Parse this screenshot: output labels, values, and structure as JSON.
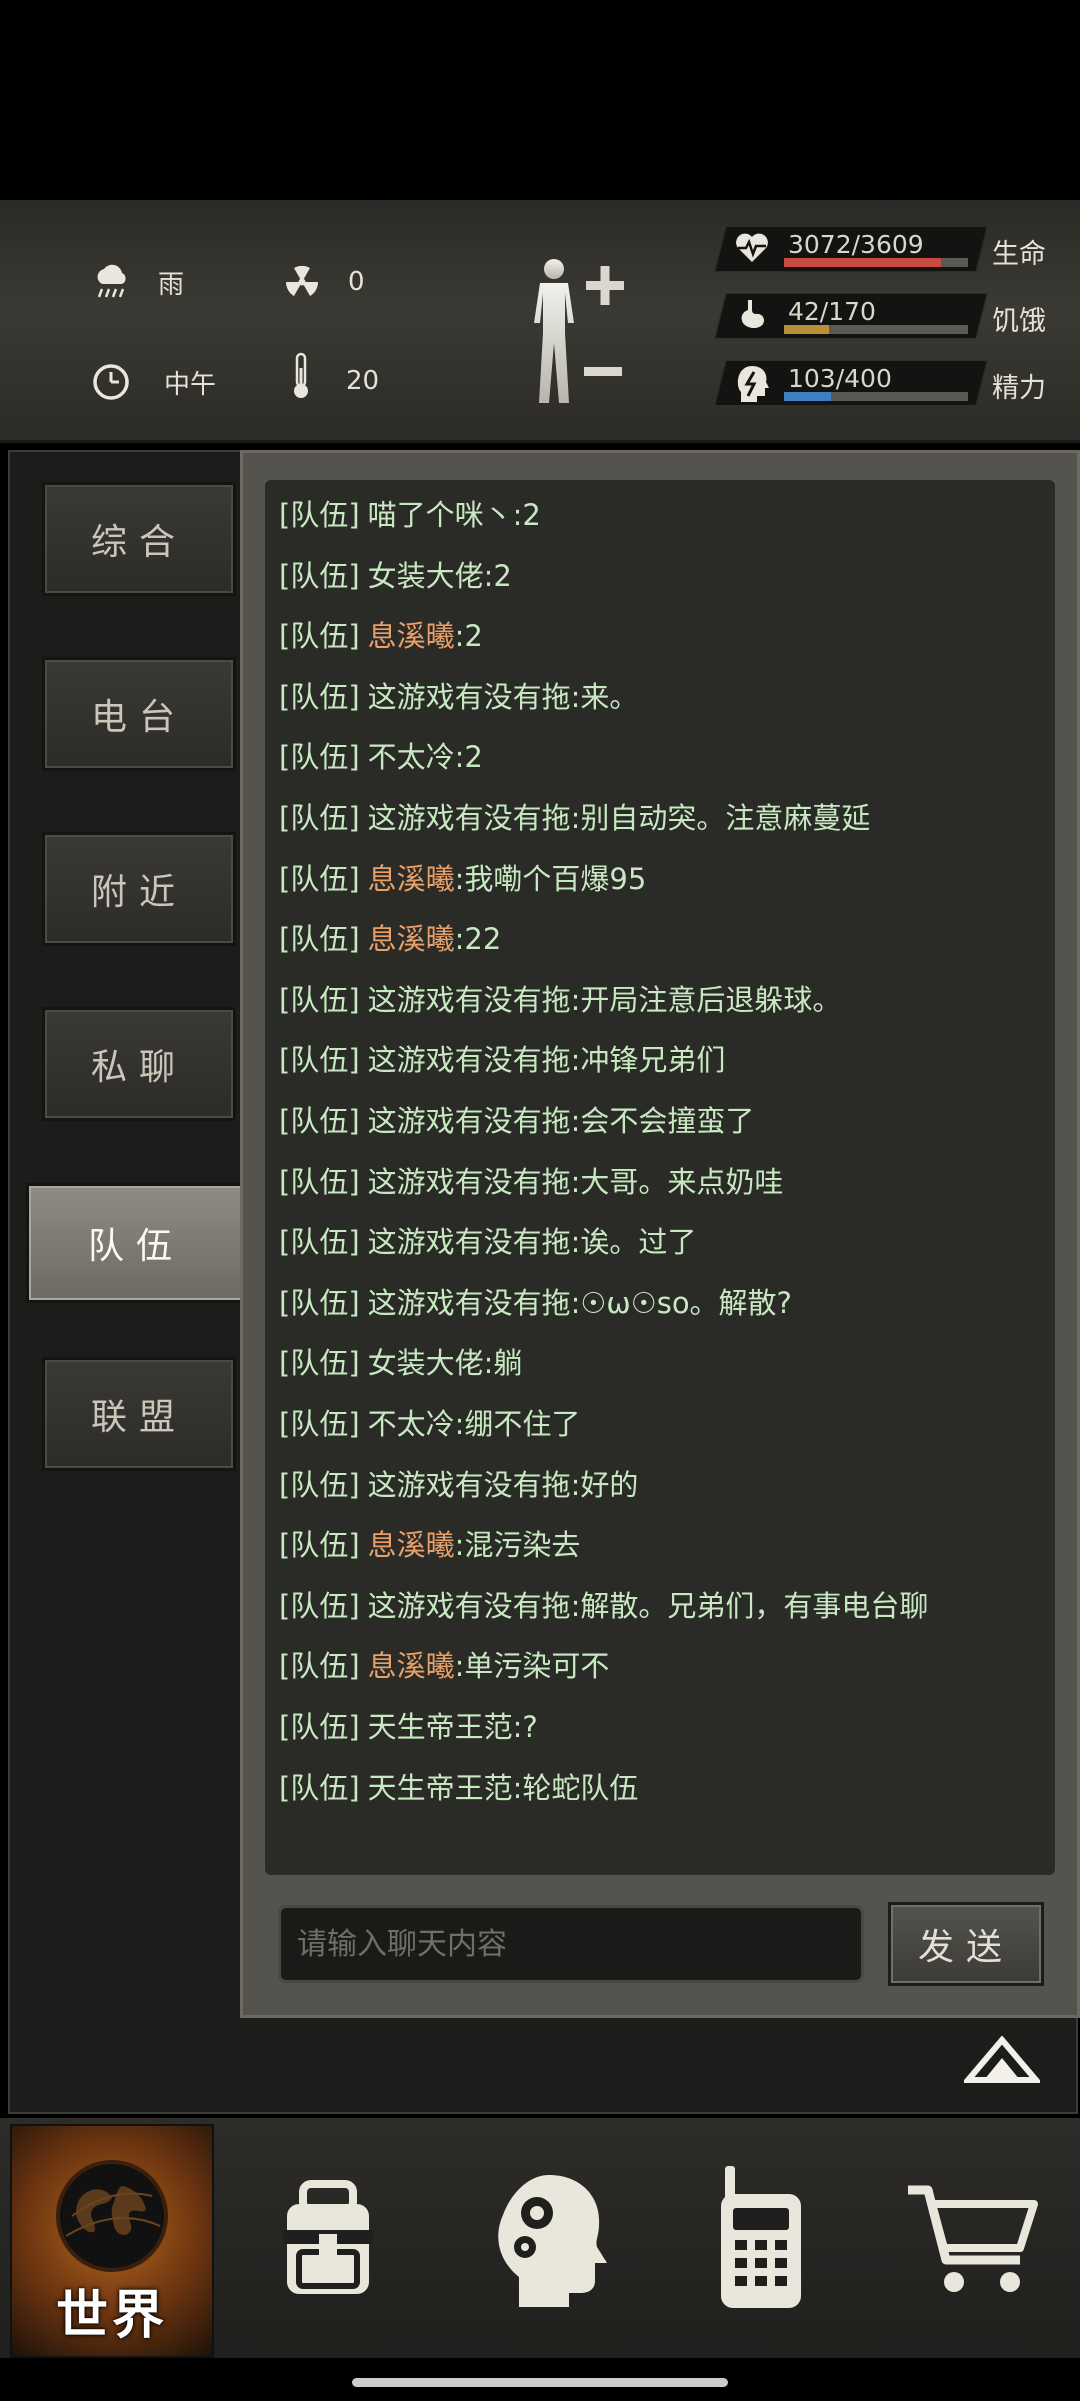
{
  "status": {
    "weather": "雨",
    "radiation": "0",
    "time_of_day": "中午",
    "temperature": "20",
    "health": {
      "value": "3072/3609",
      "label": "生命",
      "fraction": 0.851,
      "color": "#c94a3e"
    },
    "hunger": {
      "value": "42/170",
      "label": "饥饿",
      "fraction": 0.247,
      "color": "#b8903a"
    },
    "energy": {
      "value": "103/400",
      "label": "精力",
      "fraction": 0.258,
      "color": "#3f7fc4"
    }
  },
  "tabs": [
    {
      "label": "综合",
      "active": false
    },
    {
      "label": "电台",
      "active": false
    },
    {
      "label": "附近",
      "active": false
    },
    {
      "label": "私聊",
      "active": false
    },
    {
      "label": "队伍",
      "active": true
    },
    {
      "label": "联盟",
      "active": false
    }
  ],
  "chat": {
    "messages": [
      {
        "channel": "[队伍]",
        "name": "喵了个咪丶",
        "text": ":2",
        "highlight": false
      },
      {
        "channel": "[队伍]",
        "name": "女装大佬",
        "text": ":2",
        "highlight": false
      },
      {
        "channel": "[队伍]",
        "name": "息溪曦",
        "text": ":2",
        "highlight": true
      },
      {
        "channel": "[队伍]",
        "name": "这游戏有没有拖",
        "text": ":来。",
        "highlight": false
      },
      {
        "channel": "[队伍]",
        "name": "不太冷",
        "text": ":2",
        "highlight": false
      },
      {
        "channel": "[队伍]",
        "name": "这游戏有没有拖",
        "text": ":别自动突。注意麻蔓延",
        "highlight": false
      },
      {
        "channel": "[队伍]",
        "name": "息溪曦",
        "text": ":我嘞个百爆95",
        "highlight": true
      },
      {
        "channel": "[队伍]",
        "name": "息溪曦",
        "text": ":22",
        "highlight": true
      },
      {
        "channel": "[队伍]",
        "name": "这游戏有没有拖",
        "text": ":开局注意后退躲球。",
        "highlight": false
      },
      {
        "channel": "[队伍]",
        "name": "这游戏有没有拖",
        "text": ":冲锋兄弟们",
        "highlight": false
      },
      {
        "channel": "[队伍]",
        "name": "这游戏有没有拖",
        "text": ":会不会撞蛮了",
        "highlight": false
      },
      {
        "channel": "[队伍]",
        "name": "这游戏有没有拖",
        "text": ":大哥。来点奶哇",
        "highlight": false
      },
      {
        "channel": "[队伍]",
        "name": "这游戏有没有拖",
        "text": ":诶。过了",
        "highlight": false
      },
      {
        "channel": "[队伍]",
        "name": "这游戏有没有拖",
        "text": ":☉ω☉so。解散?",
        "highlight": false
      },
      {
        "channel": "[队伍]",
        "name": "女装大佬",
        "text": ":躺",
        "highlight": false
      },
      {
        "channel": "[队伍]",
        "name": "不太冷",
        "text": ":绷不住了",
        "highlight": false
      },
      {
        "channel": "[队伍]",
        "name": "这游戏有没有拖",
        "text": ":好的",
        "highlight": false
      },
      {
        "channel": "[队伍]",
        "name": "息溪曦",
        "text": ":混污染去",
        "highlight": true
      },
      {
        "channel": "[队伍]",
        "name": "这游戏有没有拖",
        "text": ":解散。兄弟们，有事电台聊",
        "highlight": false
      },
      {
        "channel": "[队伍]",
        "name": "息溪曦",
        "text": ":单污染可不",
        "highlight": true
      },
      {
        "channel": "[队伍]",
        "name": "天生帝王范",
        "text": ":?",
        "highlight": false
      },
      {
        "channel": "[队伍]",
        "name": "天生帝王范",
        "text": ":轮蛇队伍",
        "highlight": false
      }
    ],
    "input_placeholder": "请输入聊天内容",
    "send_label": "发送"
  },
  "nav": {
    "world_label": "世界",
    "items": [
      "world-icon",
      "backpack-icon",
      "skills-head-icon",
      "radio-icon",
      "cart-icon"
    ]
  }
}
